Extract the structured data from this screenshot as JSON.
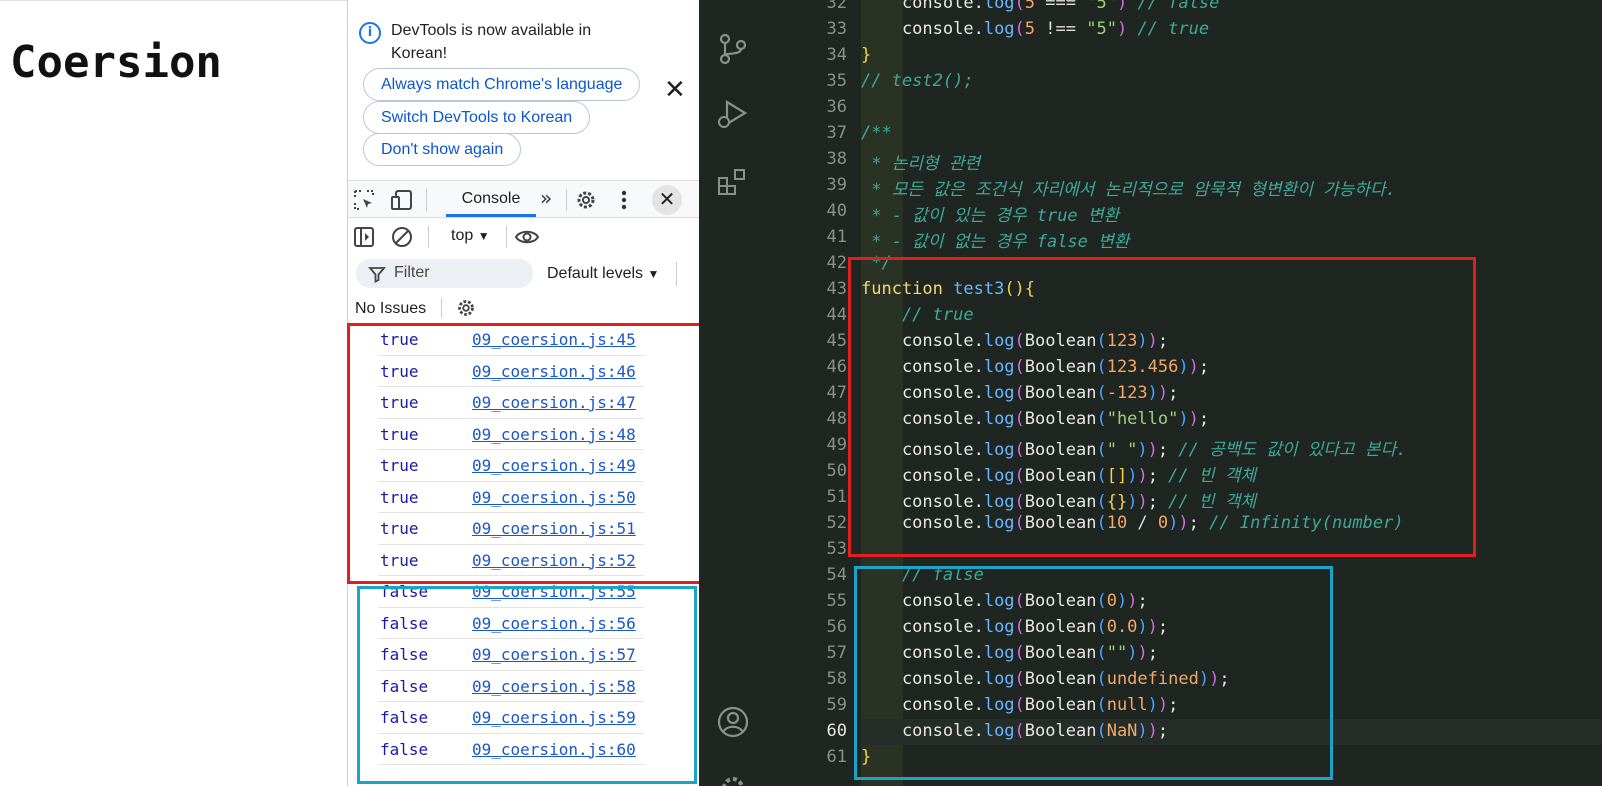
{
  "page": {
    "title": "Coersion"
  },
  "devtools": {
    "banner": {
      "message": "DevTools is now available in Korean!",
      "buttons": [
        "Always match Chrome's language",
        "Switch DevTools to Korean",
        "Don't show again"
      ],
      "close": "✕"
    },
    "tabs": {
      "active": "Console",
      "more": "»",
      "close": "✕"
    },
    "context": "top",
    "filter_placeholder": "Filter",
    "levels": "Default levels",
    "issues": "No Issues",
    "logs": [
      {
        "value": "true",
        "source": "09_coersion.js:45"
      },
      {
        "value": "true",
        "source": "09_coersion.js:46"
      },
      {
        "value": "true",
        "source": "09_coersion.js:47"
      },
      {
        "value": "true",
        "source": "09_coersion.js:48"
      },
      {
        "value": "true",
        "source": "09_coersion.js:49"
      },
      {
        "value": "true",
        "source": "09_coersion.js:50"
      },
      {
        "value": "true",
        "source": "09_coersion.js:51"
      },
      {
        "value": "true",
        "source": "09_coersion.js:52"
      },
      {
        "value": "false",
        "source": "09_coersion.js:55"
      },
      {
        "value": "false",
        "source": "09_coersion.js:56"
      },
      {
        "value": "false",
        "source": "09_coersion.js:57"
      },
      {
        "value": "false",
        "source": "09_coersion.js:58"
      },
      {
        "value": "false",
        "source": "09_coersion.js:59"
      },
      {
        "value": "false",
        "source": "09_coersion.js:60"
      }
    ]
  },
  "editor": {
    "active_line": "60",
    "lines": [
      {
        "num": "32",
        "segs": [
          [
            "v",
            "    console."
          ],
          [
            "fn",
            "log"
          ],
          [
            "p2",
            "("
          ],
          [
            "n",
            "5"
          ],
          [
            "op",
            " === "
          ],
          [
            "s",
            "\"5\""
          ],
          [
            "p2",
            ")"
          ],
          [
            "c",
            " // false"
          ]
        ]
      },
      {
        "num": "33",
        "segs": [
          [
            "v",
            "    console."
          ],
          [
            "fn",
            "log"
          ],
          [
            "p2",
            "("
          ],
          [
            "n",
            "5"
          ],
          [
            "op",
            " !== "
          ],
          [
            "s",
            "\"5\""
          ],
          [
            "p2",
            ")"
          ],
          [
            "c",
            " // true"
          ]
        ]
      },
      {
        "num": "34",
        "segs": [
          [
            "p1",
            "}"
          ]
        ]
      },
      {
        "num": "35",
        "segs": [
          [
            "c",
            "// test2();"
          ]
        ]
      },
      {
        "num": "36",
        "segs": []
      },
      {
        "num": "37",
        "segs": [
          [
            "c",
            "/**"
          ]
        ]
      },
      {
        "num": "38",
        "segs": [
          [
            "c",
            " * 논리형 관련"
          ]
        ]
      },
      {
        "num": "39",
        "segs": [
          [
            "c",
            " * 모든 값은 조건식 자리에서 논리적으로 암묵적 형변환이 가능하다."
          ]
        ]
      },
      {
        "num": "40",
        "segs": [
          [
            "c",
            " * - 값이 있는 경우 true 변환"
          ]
        ]
      },
      {
        "num": "41",
        "segs": [
          [
            "c",
            " * - 값이 없는 경우 false 변환"
          ]
        ]
      },
      {
        "num": "42",
        "segs": [
          [
            "c",
            " */"
          ]
        ]
      },
      {
        "num": "43",
        "segs": [
          [
            "k",
            "function "
          ],
          [
            "fn",
            "test3"
          ],
          [
            "p1",
            "()"
          ],
          [
            "p1",
            "{"
          ]
        ]
      },
      {
        "num": "44",
        "segs": [
          [
            "c",
            "    // true"
          ]
        ]
      },
      {
        "num": "45",
        "segs": [
          [
            "v",
            "    console."
          ],
          [
            "fn",
            "log"
          ],
          [
            "p2",
            "("
          ],
          [
            "v",
            "Boolean"
          ],
          [
            "p3",
            "("
          ],
          [
            "n",
            "123"
          ],
          [
            "p3",
            ")"
          ],
          [
            "p2",
            ")"
          ],
          [
            "v",
            ";"
          ]
        ]
      },
      {
        "num": "46",
        "segs": [
          [
            "v",
            "    console."
          ],
          [
            "fn",
            "log"
          ],
          [
            "p2",
            "("
          ],
          [
            "v",
            "Boolean"
          ],
          [
            "p3",
            "("
          ],
          [
            "n",
            "123.456"
          ],
          [
            "p3",
            ")"
          ],
          [
            "p2",
            ")"
          ],
          [
            "v",
            ";"
          ]
        ]
      },
      {
        "num": "47",
        "segs": [
          [
            "v",
            "    console."
          ],
          [
            "fn",
            "log"
          ],
          [
            "p2",
            "("
          ],
          [
            "v",
            "Boolean"
          ],
          [
            "p3",
            "("
          ],
          [
            "n",
            "-123"
          ],
          [
            "p3",
            ")"
          ],
          [
            "p2",
            ")"
          ],
          [
            "v",
            ";"
          ]
        ]
      },
      {
        "num": "48",
        "segs": [
          [
            "v",
            "    console."
          ],
          [
            "fn",
            "log"
          ],
          [
            "p2",
            "("
          ],
          [
            "v",
            "Boolean"
          ],
          [
            "p3",
            "("
          ],
          [
            "s",
            "\"hello\""
          ],
          [
            "p3",
            ")"
          ],
          [
            "p2",
            ")"
          ],
          [
            "v",
            ";"
          ]
        ]
      },
      {
        "num": "49",
        "segs": [
          [
            "v",
            "    console."
          ],
          [
            "fn",
            "log"
          ],
          [
            "p2",
            "("
          ],
          [
            "v",
            "Boolean"
          ],
          [
            "p3",
            "("
          ],
          [
            "s",
            "\" \""
          ],
          [
            "p3",
            ")"
          ],
          [
            "p2",
            ")"
          ],
          [
            "v",
            "; "
          ],
          [
            "c",
            "// 공백도 값이 있다고 본다."
          ]
        ]
      },
      {
        "num": "50",
        "segs": [
          [
            "v",
            "    console."
          ],
          [
            "fn",
            "log"
          ],
          [
            "p2",
            "("
          ],
          [
            "v",
            "Boolean"
          ],
          [
            "p3",
            "("
          ],
          [
            "p1",
            "[]"
          ],
          [
            "p3",
            ")"
          ],
          [
            "p2",
            ")"
          ],
          [
            "v",
            "; "
          ],
          [
            "c",
            "// 빈 객체"
          ]
        ]
      },
      {
        "num": "51",
        "segs": [
          [
            "v",
            "    console."
          ],
          [
            "fn",
            "log"
          ],
          [
            "p2",
            "("
          ],
          [
            "v",
            "Boolean"
          ],
          [
            "p3",
            "("
          ],
          [
            "p1",
            "{}"
          ],
          [
            "p3",
            ")"
          ],
          [
            "p2",
            ")"
          ],
          [
            "v",
            "; "
          ],
          [
            "c",
            "// 빈 객체"
          ]
        ]
      },
      {
        "num": "52",
        "segs": [
          [
            "v",
            "    console."
          ],
          [
            "fn",
            "log"
          ],
          [
            "p2",
            "("
          ],
          [
            "v",
            "Boolean"
          ],
          [
            "p3",
            "("
          ],
          [
            "n",
            "10"
          ],
          [
            "op",
            " / "
          ],
          [
            "n",
            "0"
          ],
          [
            "p3",
            ")"
          ],
          [
            "p2",
            ")"
          ],
          [
            "v",
            "; "
          ],
          [
            "c",
            "// Infinity(number)"
          ]
        ]
      },
      {
        "num": "53",
        "segs": []
      },
      {
        "num": "54",
        "segs": [
          [
            "c",
            "    // false"
          ]
        ]
      },
      {
        "num": "55",
        "segs": [
          [
            "v",
            "    console."
          ],
          [
            "fn",
            "log"
          ],
          [
            "p2",
            "("
          ],
          [
            "v",
            "Boolean"
          ],
          [
            "p3",
            "("
          ],
          [
            "n",
            "0"
          ],
          [
            "p3",
            ")"
          ],
          [
            "p2",
            ")"
          ],
          [
            "v",
            ";"
          ]
        ]
      },
      {
        "num": "56",
        "segs": [
          [
            "v",
            "    console."
          ],
          [
            "fn",
            "log"
          ],
          [
            "p2",
            "("
          ],
          [
            "v",
            "Boolean"
          ],
          [
            "p3",
            "("
          ],
          [
            "n",
            "0.0"
          ],
          [
            "p3",
            ")"
          ],
          [
            "p2",
            ")"
          ],
          [
            "v",
            ";"
          ]
        ]
      },
      {
        "num": "57",
        "segs": [
          [
            "v",
            "    console."
          ],
          [
            "fn",
            "log"
          ],
          [
            "p2",
            "("
          ],
          [
            "v",
            "Boolean"
          ],
          [
            "p3",
            "("
          ],
          [
            "s",
            "\"\""
          ],
          [
            "p3",
            ")"
          ],
          [
            "p2",
            ")"
          ],
          [
            "v",
            ";"
          ]
        ]
      },
      {
        "num": "58",
        "segs": [
          [
            "v",
            "    console."
          ],
          [
            "fn",
            "log"
          ],
          [
            "p2",
            "("
          ],
          [
            "v",
            "Boolean"
          ],
          [
            "p3",
            "("
          ],
          [
            "n",
            "undefined"
          ],
          [
            "p3",
            ")"
          ],
          [
            "p2",
            ")"
          ],
          [
            "v",
            ";"
          ]
        ]
      },
      {
        "num": "59",
        "segs": [
          [
            "v",
            "    console."
          ],
          [
            "fn",
            "log"
          ],
          [
            "p2",
            "("
          ],
          [
            "v",
            "Boolean"
          ],
          [
            "p3",
            "("
          ],
          [
            "n",
            "null"
          ],
          [
            "p3",
            ")"
          ],
          [
            "p2",
            ")"
          ],
          [
            "v",
            ";"
          ]
        ]
      },
      {
        "num": "60",
        "segs": [
          [
            "v",
            "    console."
          ],
          [
            "fn",
            "log"
          ],
          [
            "p2",
            "("
          ],
          [
            "v",
            "Boolean"
          ],
          [
            "p3",
            "("
          ],
          [
            "n",
            "NaN"
          ],
          [
            "p3",
            ")"
          ],
          [
            "p2",
            ")"
          ],
          [
            "v",
            ";"
          ]
        ]
      },
      {
        "num": "61",
        "segs": [
          [
            "p1",
            "}"
          ]
        ]
      }
    ]
  },
  "colors": {
    "highlight_red": "#e02020",
    "highlight_blue": "#1aa4c8",
    "editor_bg": "#1f2520"
  },
  "icons": [
    "info-icon",
    "inspect-icon",
    "device-icon",
    "gear-icon",
    "more-vert-icon",
    "close-icon",
    "sidebar-icon",
    "clear-icon",
    "eye-icon",
    "filter-icon",
    "source-control-icon",
    "run-debug-icon",
    "extensions-icon",
    "account-icon",
    "manage-icon"
  ]
}
